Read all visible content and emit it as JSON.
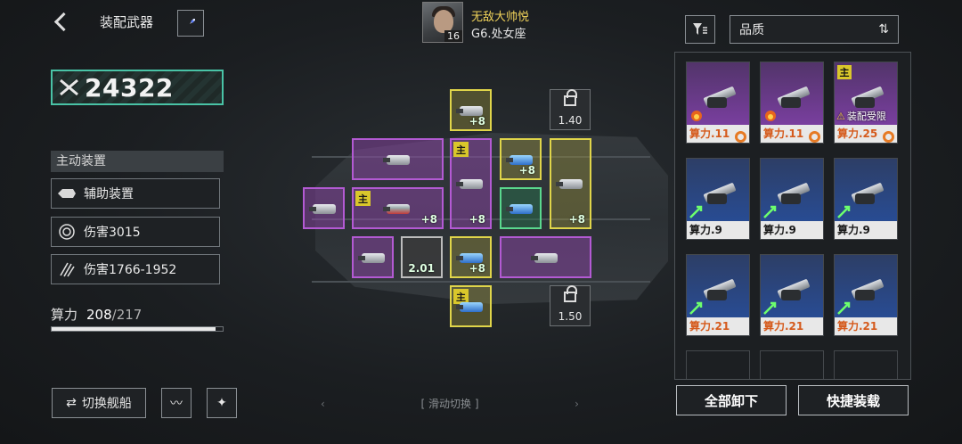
{
  "header": {
    "title": "装配武器"
  },
  "power": {
    "value": "24322"
  },
  "active_section": {
    "label": "主动装置",
    "items": [
      {
        "label": "辅助装置",
        "icon": "ship-icon"
      },
      {
        "label": "伤害3015",
        "icon": "target-icon"
      },
      {
        "label": "伤害1766-1952",
        "icon": "claw-icon"
      }
    ]
  },
  "capacity": {
    "label": "算力",
    "current": "208",
    "max": "/217",
    "ratio": 0.958
  },
  "bottom": {
    "switch_label": "切换舰船"
  },
  "commander": {
    "name": "无敌大帅悦",
    "level": "16",
    "sub": "G6.处女座"
  },
  "slots": {
    "plus": "+8",
    "main_tag": "主",
    "lock_top": "1.40",
    "lock_bottom": "1.50",
    "lock_mid": "2.01"
  },
  "swipe": {
    "label": "滑动切换"
  },
  "inventory": {
    "sort_label": "品质",
    "cards": [
      {
        "power": "算力.11",
        "quality": "purple",
        "gear": true
      },
      {
        "power": "算力.11",
        "quality": "purple",
        "gear": true
      },
      {
        "power": "算力.25",
        "quality": "purple",
        "gear": true,
        "main": true,
        "restrict": "装配受限"
      },
      {
        "power": "算力.9",
        "quality": "blue"
      },
      {
        "power": "算力.9",
        "quality": "blue"
      },
      {
        "power": "算力.9",
        "quality": "blue"
      },
      {
        "power": "算力.21",
        "quality": "blue"
      },
      {
        "power": "算力.21",
        "quality": "blue"
      },
      {
        "power": "算力.21",
        "quality": "blue"
      }
    ],
    "unload_all": "全部卸下",
    "quick_equip": "快捷装载"
  },
  "colors": {
    "accent_teal": "#49c3a6",
    "purple": "#b35ad3",
    "yellow": "#e0d54a",
    "green": "#5ad88e",
    "orange": "#d55a1c"
  }
}
